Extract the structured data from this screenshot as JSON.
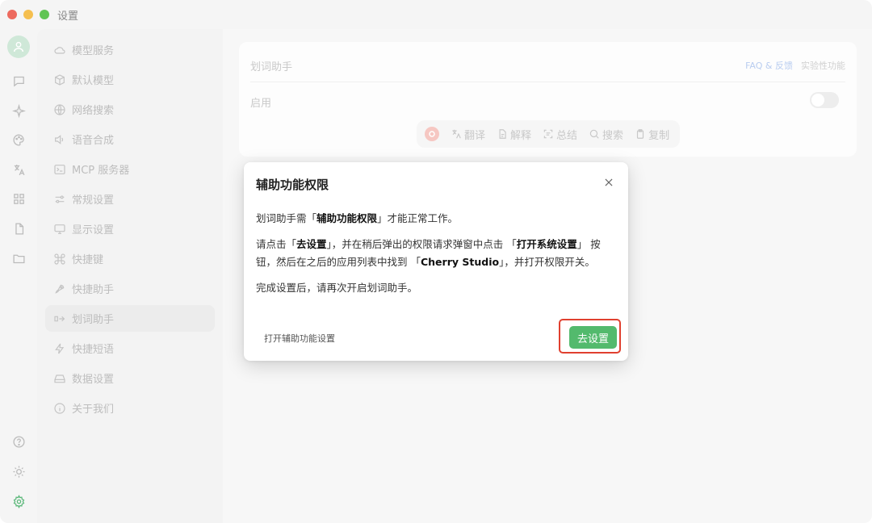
{
  "window": {
    "title": "设置"
  },
  "nav": {
    "items": [
      {
        "label": "模型服务",
        "icon": "cloud-icon"
      },
      {
        "label": "默认模型",
        "icon": "cube-icon"
      },
      {
        "label": "网络搜索",
        "icon": "globe-icon"
      },
      {
        "label": "语音合成",
        "icon": "speaker-icon"
      },
      {
        "label": "MCP 服务器",
        "icon": "terminal-icon"
      },
      {
        "label": "常规设置",
        "icon": "sliders-icon"
      },
      {
        "label": "显示设置",
        "icon": "monitor-icon"
      },
      {
        "label": "快捷键",
        "icon": "command-icon"
      },
      {
        "label": "快捷助手",
        "icon": "rocket-icon"
      },
      {
        "label": "划词助手",
        "icon": "text-select-icon",
        "active": true
      },
      {
        "label": "快捷短语",
        "icon": "zap-icon"
      },
      {
        "label": "数据设置",
        "icon": "hard-drive-icon"
      },
      {
        "label": "关于我们",
        "icon": "info-icon"
      }
    ]
  },
  "card": {
    "title": "划词助手",
    "faq_link": "FAQ & 反馈",
    "experimental_link": "实验性功能",
    "enable_label": "启用",
    "toolbar": {
      "translate": "翻译",
      "explain": "解释",
      "summarize": "总结",
      "search": "搜索",
      "copy": "复制"
    }
  },
  "modal": {
    "title": "辅助功能权限",
    "p1_a": "划词助手需「",
    "p1_b": "辅助功能权限",
    "p1_c": "」才能正常工作。",
    "p2_a": "请点击「",
    "p2_b": "去设置",
    "p2_c": "」，并在稍后弹出的权限请求弹窗中点击 「",
    "p2_d": "打开系统设置",
    "p2_e": "」 按钮，然后在之后的应用列表中找到 「",
    "p2_f": "Cherry Studio",
    "p2_g": "」，并打开权限开关。",
    "p3": "完成设置后，请再次开启划词助手。",
    "open_settings_link": "打开辅助功能设置",
    "go_button": "去设置"
  },
  "colors": {
    "accent_green": "#53ba6d",
    "highlight_red": "#e0402f"
  }
}
